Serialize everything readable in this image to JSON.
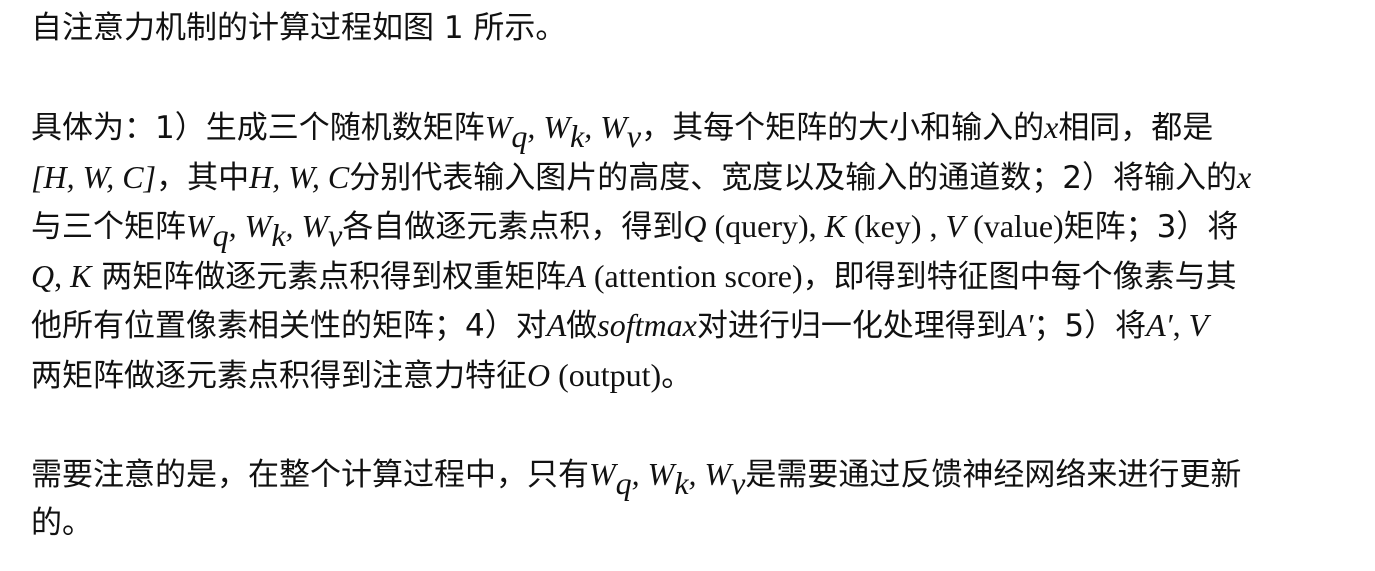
{
  "document": {
    "paragraphs": [
      {
        "lines": [
          [
            {
              "t": "t",
              "v": "自注意力机制的计算过程如图 1 所示。"
            }
          ]
        ]
      },
      {
        "lines": [
          [
            {
              "t": "t",
              "v": "具体为：1）生成三个随机数矩阵"
            },
            {
              "t": "m",
              "v": "W"
            },
            {
              "t": "sub",
              "v": "q"
            },
            {
              "t": "m",
              "v": ", W"
            },
            {
              "t": "sub",
              "v": "k"
            },
            {
              "t": "m",
              "v": ", W"
            },
            {
              "t": "sub",
              "v": "v"
            },
            {
              "t": "t",
              "v": "，其每个矩阵的大小和输入的"
            },
            {
              "t": "m",
              "v": "x"
            },
            {
              "t": "t",
              "v": "相同，都是"
            }
          ],
          [
            {
              "t": "m",
              "v": "[H, W, C]"
            },
            {
              "t": "t",
              "v": "，其中"
            },
            {
              "t": "m",
              "v": "H, W, C"
            },
            {
              "t": "t",
              "v": "分别代表输入图片的高度、宽度以及输入的通道数；2）将输入的"
            },
            {
              "t": "m",
              "v": "x"
            }
          ],
          [
            {
              "t": "t",
              "v": "与三个矩阵"
            },
            {
              "t": "m",
              "v": "W"
            },
            {
              "t": "sub",
              "v": "q"
            },
            {
              "t": "m",
              "v": ", W"
            },
            {
              "t": "sub",
              "v": "k"
            },
            {
              "t": "m",
              "v": ", W"
            },
            {
              "t": "sub",
              "v": "v"
            },
            {
              "t": "t",
              "v": "各自做逐元素点积，得到"
            },
            {
              "t": "m",
              "v": "Q"
            },
            {
              "t": "r",
              "v": " (query), "
            },
            {
              "t": "m",
              "v": "K"
            },
            {
              "t": "r",
              "v": " (key) , "
            },
            {
              "t": "m",
              "v": "V"
            },
            {
              "t": "r",
              "v": " (value)"
            },
            {
              "t": "t",
              "v": "矩阵；3）将"
            }
          ],
          [
            {
              "t": "m",
              "v": "Q"
            },
            {
              "t": "r",
              "v": ", "
            },
            {
              "t": "m",
              "v": "K"
            },
            {
              "t": "t",
              "v": " 两矩阵做逐元素点积得到权重矩阵"
            },
            {
              "t": "m",
              "v": "A"
            },
            {
              "t": "r",
              "v": " (attention score)"
            },
            {
              "t": "t",
              "v": "，即得到特征图中每个像素与其"
            }
          ],
          [
            {
              "t": "t",
              "v": "他所有位置像素相关性的矩阵；4）对"
            },
            {
              "t": "m",
              "v": "A"
            },
            {
              "t": "t",
              "v": "做"
            },
            {
              "t": "m",
              "v": "softmax"
            },
            {
              "t": "t",
              "v": "对进行归一化处理得到"
            },
            {
              "t": "m",
              "v": "A′"
            },
            {
              "t": "t",
              "v": "；5）将"
            },
            {
              "t": "m",
              "v": "A′"
            },
            {
              "t": "r",
              "v": ", "
            },
            {
              "t": "m",
              "v": "V"
            }
          ],
          [
            {
              "t": "t",
              "v": "两矩阵做逐元素点积得到注意力特征"
            },
            {
              "t": "m",
              "v": "O"
            },
            {
              "t": "r",
              "v": " (output)"
            },
            {
              "t": "t",
              "v": "。"
            }
          ]
        ]
      },
      {
        "lines": [
          [
            {
              "t": "t",
              "v": "需要注意的是，在整个计算过程中，只有"
            },
            {
              "t": "m",
              "v": "W"
            },
            {
              "t": "sub",
              "v": "q"
            },
            {
              "t": "m",
              "v": ", W"
            },
            {
              "t": "sub",
              "v": "k"
            },
            {
              "t": "m",
              "v": ", W"
            },
            {
              "t": "sub",
              "v": "v"
            },
            {
              "t": "t",
              "v": "是需要通过反馈神经网络来进行更新"
            }
          ],
          [
            {
              "t": "t",
              "v": "的。"
            }
          ]
        ]
      }
    ]
  }
}
